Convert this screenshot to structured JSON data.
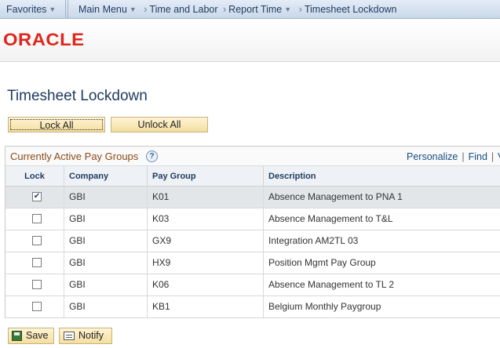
{
  "nav": {
    "favorites": "Favorites",
    "main_menu": "Main Menu",
    "crumbs": [
      "Time and Labor",
      "Report Time",
      "Timesheet Lockdown"
    ]
  },
  "brand": {
    "logo_text": "ORACLE",
    "logo_color": "#e0261b"
  },
  "page": {
    "title": "Timesheet Lockdown"
  },
  "actions": {
    "lock_all": "Lock All",
    "unlock_all": "Unlock All"
  },
  "grid": {
    "title": "Currently Active Pay Groups",
    "help": "?",
    "links": {
      "personalize": "Personalize",
      "find": "Find",
      "view": "V"
    },
    "columns": [
      "Lock",
      "Company",
      "Pay Group",
      "Description"
    ],
    "rows": [
      {
        "lock": true,
        "company": "GBI",
        "pay_group": "K01",
        "description": "Absence Management to PNA 1"
      },
      {
        "lock": false,
        "company": "GBI",
        "pay_group": "K03",
        "description": "Absence Management to T&L"
      },
      {
        "lock": false,
        "company": "GBI",
        "pay_group": "GX9",
        "description": "Integration AM2TL 03"
      },
      {
        "lock": false,
        "company": "GBI",
        "pay_group": "HX9",
        "description": "Position Mgmt Pay Group"
      },
      {
        "lock": false,
        "company": "GBI",
        "pay_group": "K06",
        "description": "Absence Management to TL 2"
      },
      {
        "lock": false,
        "company": "GBI",
        "pay_group": "KB1",
        "description": "Belgium Monthly Paygroup"
      }
    ]
  },
  "footer": {
    "save": "Save",
    "notify": "Notify"
  }
}
